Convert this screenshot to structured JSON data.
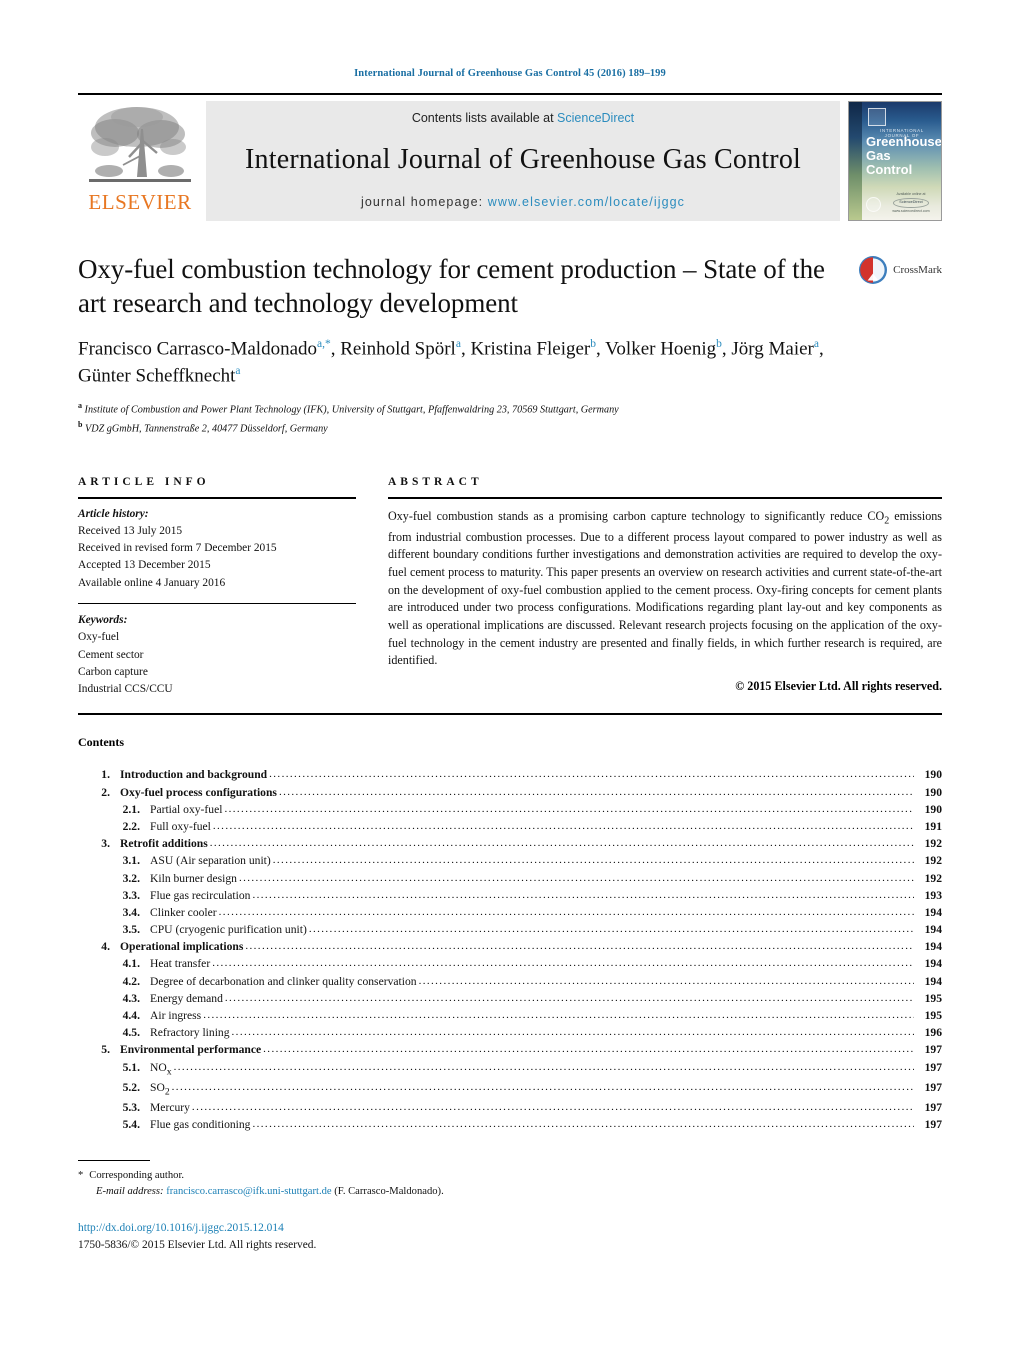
{
  "running_head": "International Journal of Greenhouse Gas Control 45 (2016) 189–199",
  "banner": {
    "contents_prefix": "Contents lists available at ",
    "sciencedirect": "ScienceDirect",
    "journal_name": "International Journal of Greenhouse Gas Control",
    "homepage_prefix": "journal homepage: ",
    "homepage_url": "www.elsevier.com/locate/ijggc",
    "publisher_wordmark": "ELSEVIER",
    "publisher_color": "#E87722",
    "link_color": "#2b8cbe"
  },
  "cover": {
    "kicker": "INTERNATIONAL JOURNAL OF",
    "line1": "Greenhouse",
    "line2": "Gas Control",
    "footer_mark": "Available online at",
    "footer_brand": "ScienceDirect",
    "footer_url": "www.sciencedirect.com"
  },
  "article": {
    "title": "Oxy-fuel combustion technology for cement production – State of the art research and technology development",
    "crossmark_label": "CrossMark",
    "authors_html": "Francisco Carrasco-Maldonado<sup>a,*</sup>, Reinhold Spörl<sup>a</sup>, Kristina Fleiger<sup>b</sup>, Volker Hoenig<sup>b</sup>, Jörg Maier<sup>a</sup>, Günter Scheffknecht<sup>a</sup>",
    "affiliation_a": "Institute of Combustion and Power Plant Technology (IFK), University of Stuttgart, Pfaffenwaldring 23, 70569 Stuttgart, Germany",
    "affiliation_b": "VDZ gGmbH, Tannenstraße 2, 40477 Düsseldorf, Germany"
  },
  "article_info": {
    "heading": "ARTICLE INFO",
    "history_label": "Article history:",
    "history": [
      "Received 13 July 2015",
      "Received in revised form 7 December 2015",
      "Accepted 13 December 2015",
      "Available online 4 January 2016"
    ],
    "keywords_label": "Keywords:",
    "keywords": [
      "Oxy-fuel",
      "Cement sector",
      "Carbon capture",
      "Industrial CCS/CCU"
    ]
  },
  "abstract": {
    "heading": "ABSTRACT",
    "text": "Oxy-fuel combustion stands as a promising carbon capture technology to significantly reduce CO2 emissions from industrial combustion processes. Due to a different process layout compared to power industry as well as different boundary conditions further investigations and demonstration activities are required to develop the oxy-fuel cement process to maturity. This paper presents an overview on research activities and current state-of-the-art on the development of oxy-fuel combustion applied to the cement process. Oxy-firing concepts for cement plants are introduced under two process configurations. Modifications regarding plant lay-out and key components as well as operational implications are discussed. Relevant research projects focusing on the application of the oxy-fuel technology in the cement industry are presented and finally fields, in which further research is required, are identified.",
    "copyright": "© 2015 Elsevier Ltd. All rights reserved."
  },
  "contents": {
    "heading": "Contents",
    "entries": [
      {
        "level": 1,
        "number": "1.",
        "label": "Introduction and background",
        "page": "190"
      },
      {
        "level": 1,
        "number": "2.",
        "label": "Oxy-fuel process configurations",
        "page": "190"
      },
      {
        "level": 2,
        "number": "2.1.",
        "label": "Partial oxy-fuel",
        "page": "190"
      },
      {
        "level": 2,
        "number": "2.2.",
        "label": "Full oxy-fuel",
        "page": "191"
      },
      {
        "level": 1,
        "number": "3.",
        "label": "Retrofit additions",
        "page": "192"
      },
      {
        "level": 2,
        "number": "3.1.",
        "label": "ASU (Air separation unit)",
        "page": "192"
      },
      {
        "level": 2,
        "number": "3.2.",
        "label": "Kiln burner design",
        "page": "192"
      },
      {
        "level": 2,
        "number": "3.3.",
        "label": "Flue gas recirculation",
        "page": "193"
      },
      {
        "level": 2,
        "number": "3.4.",
        "label": "Clinker cooler",
        "page": "194"
      },
      {
        "level": 2,
        "number": "3.5.",
        "label": "CPU (cryogenic purification unit)",
        "page": "194"
      },
      {
        "level": 1,
        "number": "4.",
        "label": "Operational implications",
        "page": "194"
      },
      {
        "level": 2,
        "number": "4.1.",
        "label": "Heat transfer",
        "page": "194"
      },
      {
        "level": 2,
        "number": "4.2.",
        "label": "Degree of decarbonation and clinker quality conservation",
        "page": "194"
      },
      {
        "level": 2,
        "number": "4.3.",
        "label": "Energy demand",
        "page": "195"
      },
      {
        "level": 2,
        "number": "4.4.",
        "label": "Air ingress",
        "page": "195"
      },
      {
        "level": 2,
        "number": "4.5.",
        "label": "Refractory lining",
        "page": "196"
      },
      {
        "level": 1,
        "number": "5.",
        "label": "Environmental performance",
        "page": "197"
      },
      {
        "level": 2,
        "number": "5.1.",
        "label": "NOx",
        "page": "197"
      },
      {
        "level": 2,
        "number": "5.2.",
        "label": "SO2",
        "page": "197"
      },
      {
        "level": 2,
        "number": "5.3.",
        "label": "Mercury",
        "page": "197"
      },
      {
        "level": 2,
        "number": "5.4.",
        "label": "Flue gas conditioning",
        "page": "197"
      }
    ]
  },
  "footer": {
    "corresponding_marker": "*",
    "corresponding_text": "Corresponding author.",
    "email_label": "E-mail address:",
    "email": "francisco.carrasco@ifk.uni-stuttgart.de",
    "email_owner": "(F. Carrasco-Maldonado).",
    "doi": "http://dx.doi.org/10.1016/j.ijggc.2015.12.014",
    "issn_line": "1750-5836/© 2015 Elsevier Ltd. All rights reserved."
  }
}
